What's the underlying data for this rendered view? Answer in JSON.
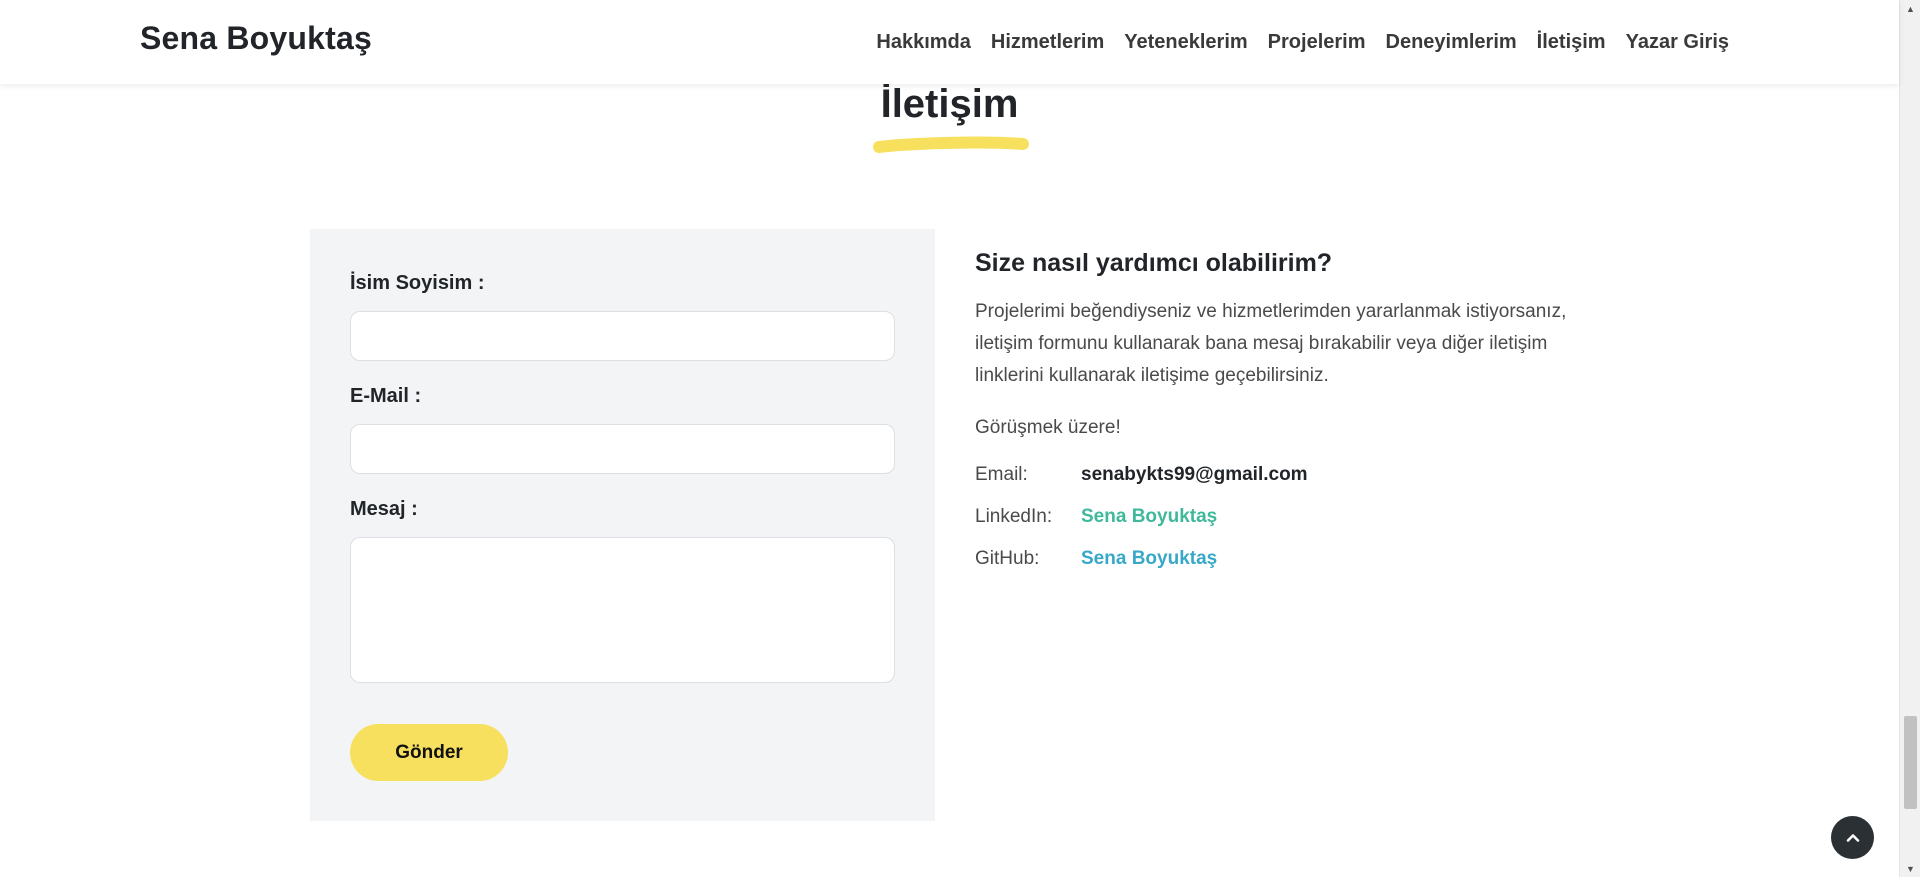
{
  "header": {
    "brand": "Sena Boyuktaş",
    "nav": [
      {
        "label": "Hakkımda"
      },
      {
        "label": "Hizmetlerim"
      },
      {
        "label": "Yeteneklerim"
      },
      {
        "label": "Projelerim"
      },
      {
        "label": "Deneyimlerim"
      },
      {
        "label": "İletişim"
      },
      {
        "label": "Yazar Giriş"
      }
    ]
  },
  "section": {
    "title": "İletişim",
    "accent_color": "#f6e05e"
  },
  "form": {
    "name_label": "İsim Soyisim :",
    "name_value": "",
    "email_label": "E-Mail :",
    "email_value": "",
    "message_label": "Mesaj :",
    "message_value": "",
    "submit_label": "Gönder"
  },
  "info": {
    "heading": "Size nasıl yardımcı olabilirim?",
    "paragraph": "Projelerimi beğendiyseniz ve hizmetlerimden yararlanmak istiyorsanız, iletişim formunu kullanarak bana mesaj bırakabilir veya diğer iletişim linklerini kullanarak iletişime geçebilirsiniz.",
    "greeting": "Görüşmek üzere!",
    "contacts": [
      {
        "key": "Email:",
        "value": "senabykts99@gmail.com"
      },
      {
        "key": "LinkedIn:",
        "value": "Sena Boyuktaş"
      },
      {
        "key": "GitHub:",
        "value": "Sena Boyuktaş"
      }
    ],
    "colors": {
      "linkedin": "#3fb89b",
      "github": "#38a8c9"
    }
  },
  "icons": {
    "back_to_top": "chevron-up-icon",
    "scroll_up": "triangle-up-icon",
    "scroll_down": "triangle-down-icon"
  }
}
